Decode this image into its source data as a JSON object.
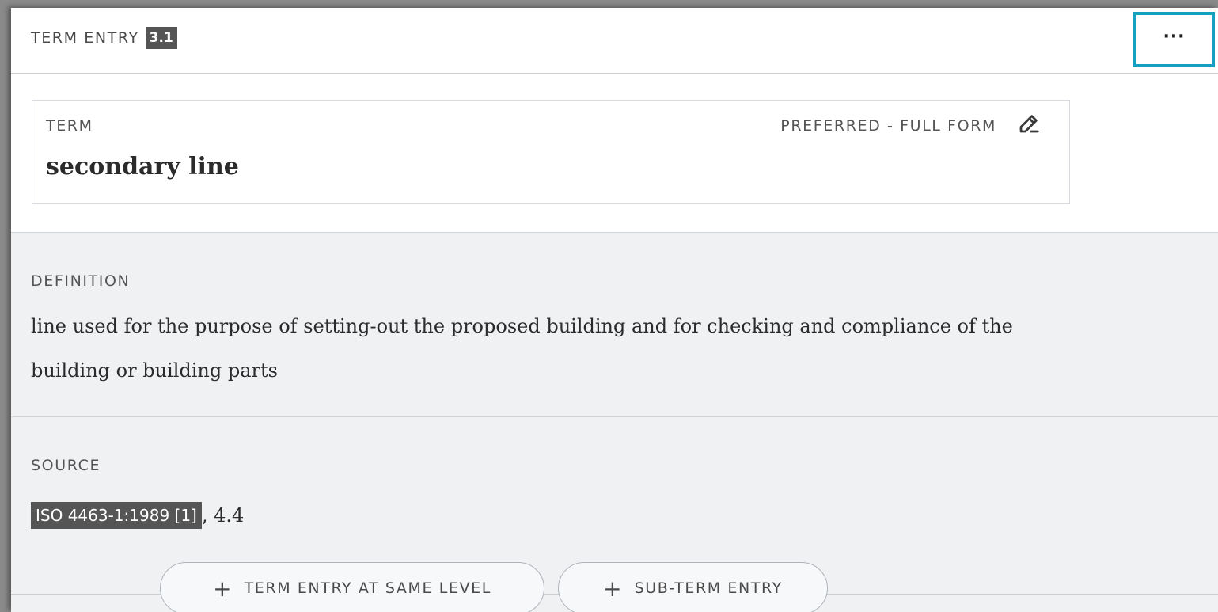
{
  "header": {
    "entry_label": "TERM ENTRY",
    "entry_number": "3.1",
    "more_label": "···"
  },
  "term": {
    "label": "TERM",
    "status": "PREFERRED - FULL FORM",
    "value": "secondary line",
    "edit_icon": "edit-pencil-icon"
  },
  "definition": {
    "label": "DEFINITION",
    "text": "line used for the purpose of setting-out the proposed building and for checking and compliance of the building or building parts"
  },
  "source": {
    "label": "SOURCE",
    "reference": "ISO 4463-1:1989 [1]",
    "suffix": ", 4.4"
  },
  "actions": {
    "plus_symbol": "+",
    "same_level_label": "TERM ENTRY AT SAME LEVEL",
    "sub_term_label": "SUB-TERM ENTRY"
  },
  "colors": {
    "accent": "#15a0c2",
    "badge": "#555555",
    "panel_gray": "#f0f1f3"
  }
}
